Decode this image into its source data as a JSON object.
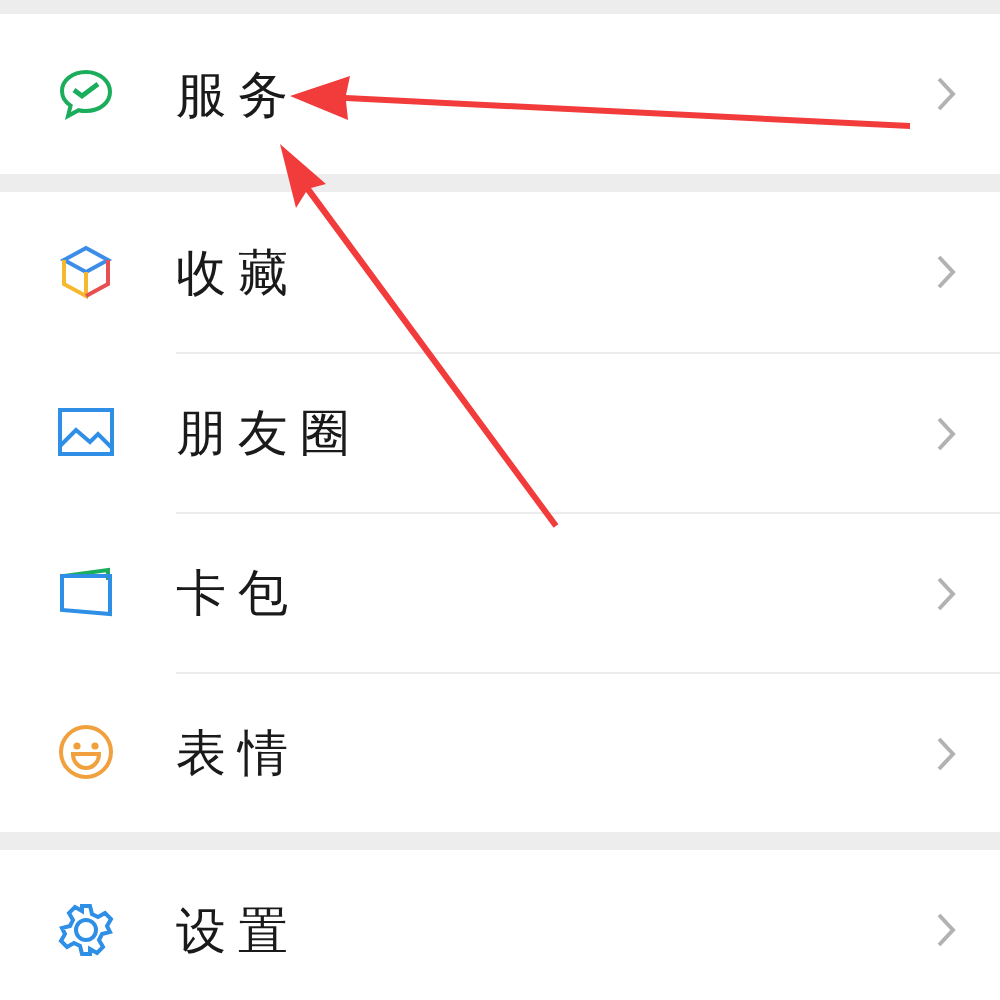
{
  "groups": [
    {
      "items": [
        {
          "kind": "service",
          "label": "服务"
        }
      ]
    },
    {
      "items": [
        {
          "kind": "favorites",
          "label": "收藏"
        },
        {
          "kind": "moments",
          "label": "朋友圈"
        },
        {
          "kind": "cards",
          "label": "卡包"
        },
        {
          "kind": "stickers",
          "label": "表情"
        }
      ]
    },
    {
      "items": [
        {
          "kind": "settings",
          "label": "设置"
        }
      ]
    }
  ]
}
